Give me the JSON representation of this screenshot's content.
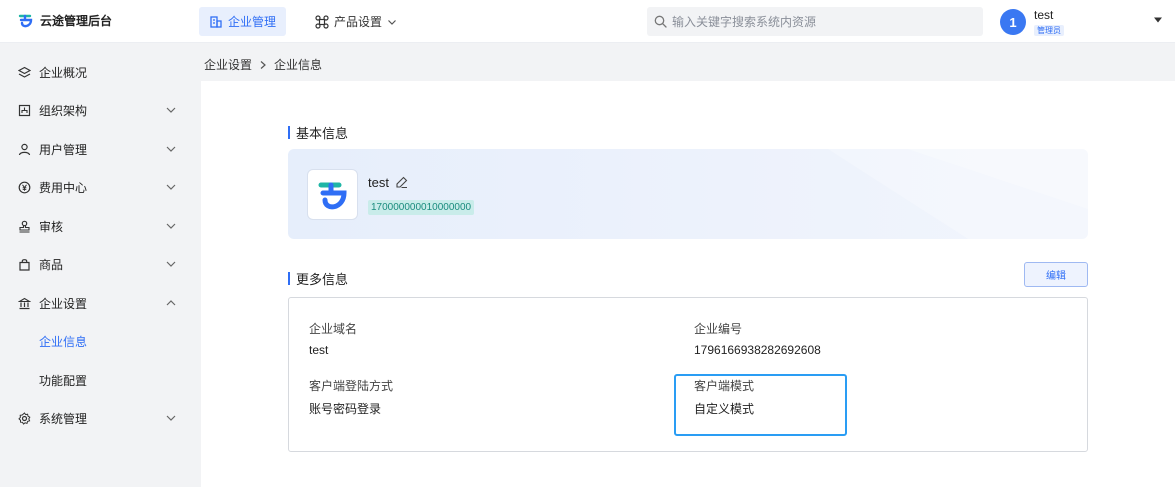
{
  "app": {
    "title": "云途管理后台"
  },
  "topnav": {
    "items": [
      {
        "label": "企业管理",
        "icon": "building-icon",
        "active": true
      },
      {
        "label": "产品设置",
        "icon": "grid-nodes-icon",
        "active": false
      }
    ]
  },
  "search": {
    "placeholder": "输入关键字搜索系统内资源"
  },
  "user": {
    "avatar_text": "1",
    "name": "test",
    "role": "管理员"
  },
  "sidebar": {
    "items": [
      {
        "label": "企业概况",
        "icon": "layers-icon"
      },
      {
        "label": "组织架构",
        "icon": "org-chart-icon"
      },
      {
        "label": "用户管理",
        "icon": "user-icon"
      },
      {
        "label": "费用中心",
        "icon": "yen-icon"
      },
      {
        "label": "审核",
        "icon": "stamp-icon"
      },
      {
        "label": "商品",
        "icon": "bag-icon"
      },
      {
        "label": "企业设置",
        "icon": "bank-icon"
      },
      {
        "label": "系统管理",
        "icon": "gear-icon"
      }
    ],
    "sub_items": [
      {
        "label": "企业信息",
        "active": true
      },
      {
        "label": "功能配置",
        "active": false
      }
    ]
  },
  "breadcrumb": {
    "parent": "企业设置",
    "current": "企业信息"
  },
  "basic": {
    "title": "基本信息",
    "name": "test",
    "id": "170000000010000000"
  },
  "more": {
    "title": "更多信息",
    "edit_label": "编辑",
    "fields": [
      {
        "label": "企业域名",
        "value": "test"
      },
      {
        "label": "企业编号",
        "value": "1796166938282692608"
      },
      {
        "label": "客户端登陆方式",
        "value": "账号密码登录"
      },
      {
        "label": "客户端模式",
        "value": "自定义模式"
      }
    ]
  },
  "colors": {
    "accent": "#2f6ef5",
    "highlight": "#2a9df4",
    "tag": "#1a8c7e"
  }
}
